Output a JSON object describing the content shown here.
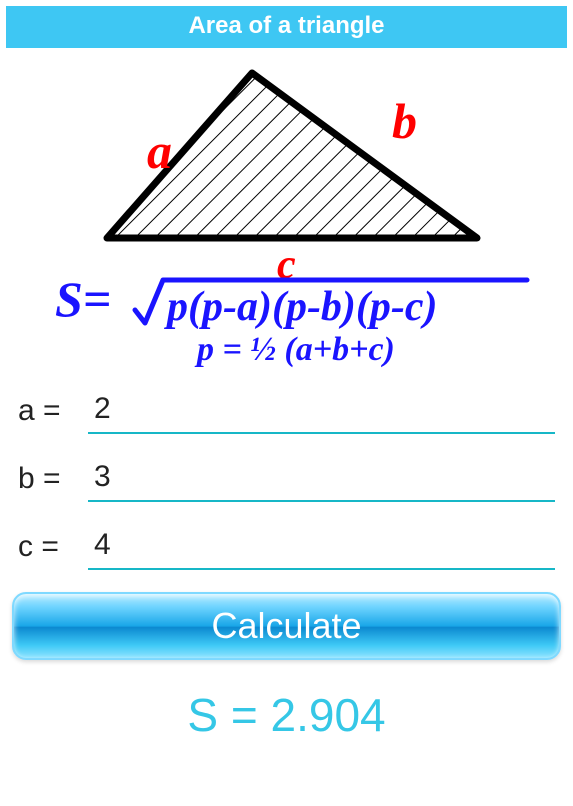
{
  "header": {
    "title": "Area of a triangle"
  },
  "diagram": {
    "side_labels": {
      "a": "a",
      "b": "b",
      "c": "c"
    },
    "formula_main_lhs": "S=",
    "formula_main_radicand": "p(p-a)(p-b)(p-c)",
    "formula_sub": "p = ½ (a+b+c)",
    "colors": {
      "sides": "#ff0000",
      "formula": "#1a14ff",
      "triangle": "#000000"
    }
  },
  "inputs": {
    "a": {
      "label": "a = ",
      "value": "2"
    },
    "b": {
      "label": "b = ",
      "value": "3"
    },
    "c": {
      "label": "c = ",
      "value": "4"
    }
  },
  "button": {
    "label": "Calculate"
  },
  "result": {
    "text": "S = 2.904"
  }
}
